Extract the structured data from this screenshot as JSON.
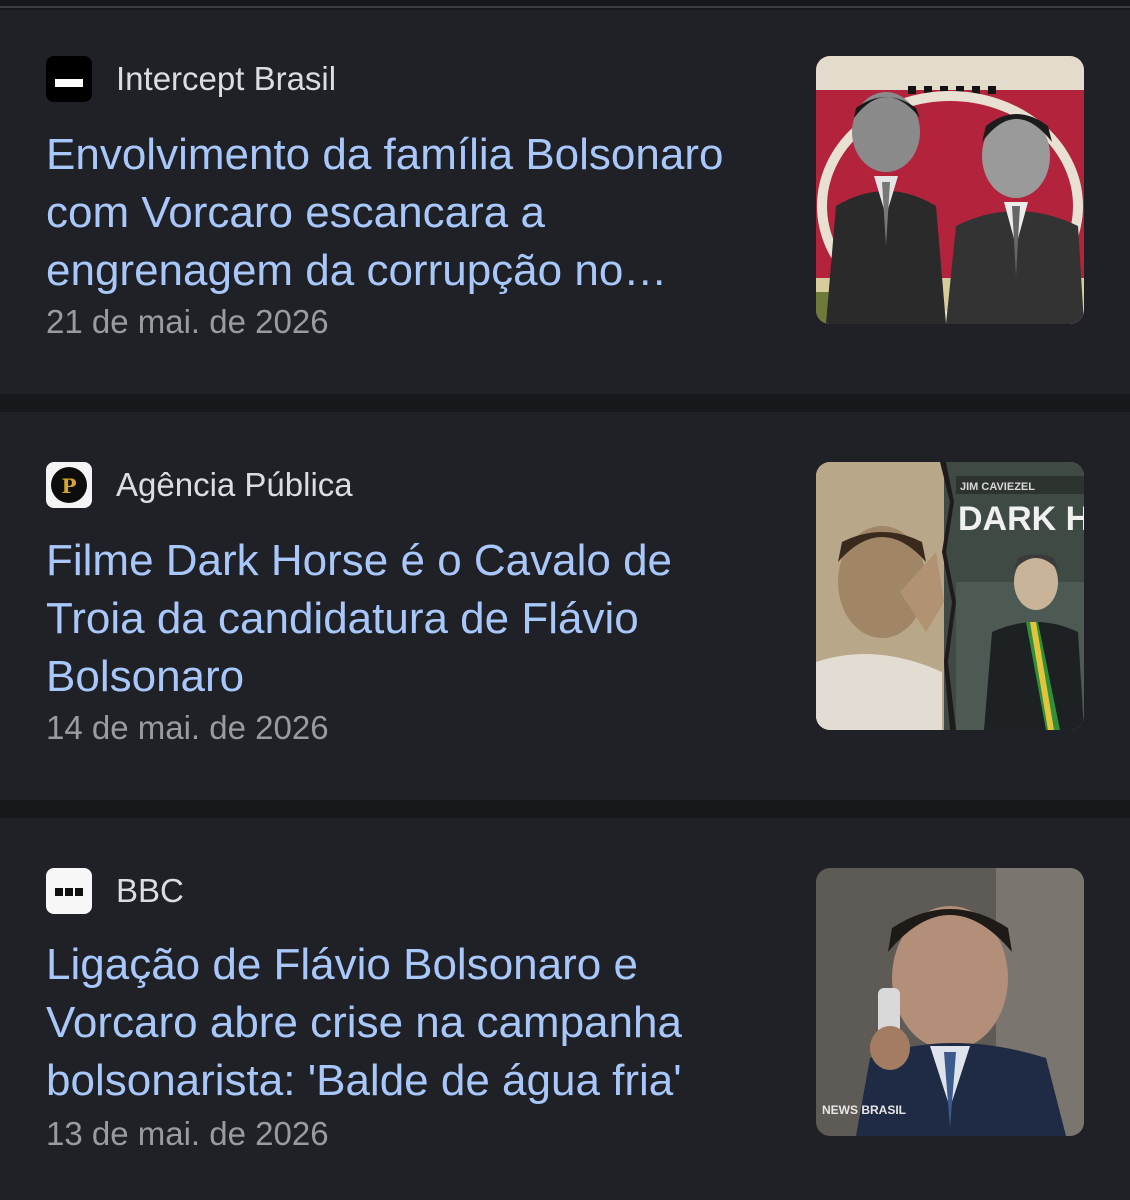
{
  "articles": [
    {
      "source": "Intercept Brasil",
      "favicon": "intercept-logo-icon",
      "headline": "Envolvimento da família Bolsonaro com Vorcaro escancara a engrenagem da corrupção no…",
      "date": "21 de mai. de 2026"
    },
    {
      "source": "Agência Pública",
      "favicon": "agencia-publica-logo-icon",
      "favicon_letter": "P",
      "headline": "Filme Dark Horse é o Cavalo de Troia da candidatura de Flávio Bolsonaro",
      "date": "14 de mai. de 2026",
      "thumb_text": "DARK HO"
    },
    {
      "source": "BBC",
      "favicon": "bbc-logo-icon",
      "headline": "Ligação de Flávio Bolsonaro e Vorcaro abre crise na campanha bolsonarista: 'Balde de água fria'",
      "date": "13 de mai. de 2026",
      "thumb_text": "NEWS BRASIL"
    }
  ],
  "colors": {
    "background": "#17181c",
    "card": "#202126",
    "headline_link": "#a8c7fa",
    "source_text": "#dcdde1",
    "date_text": "#9a9ba0"
  }
}
